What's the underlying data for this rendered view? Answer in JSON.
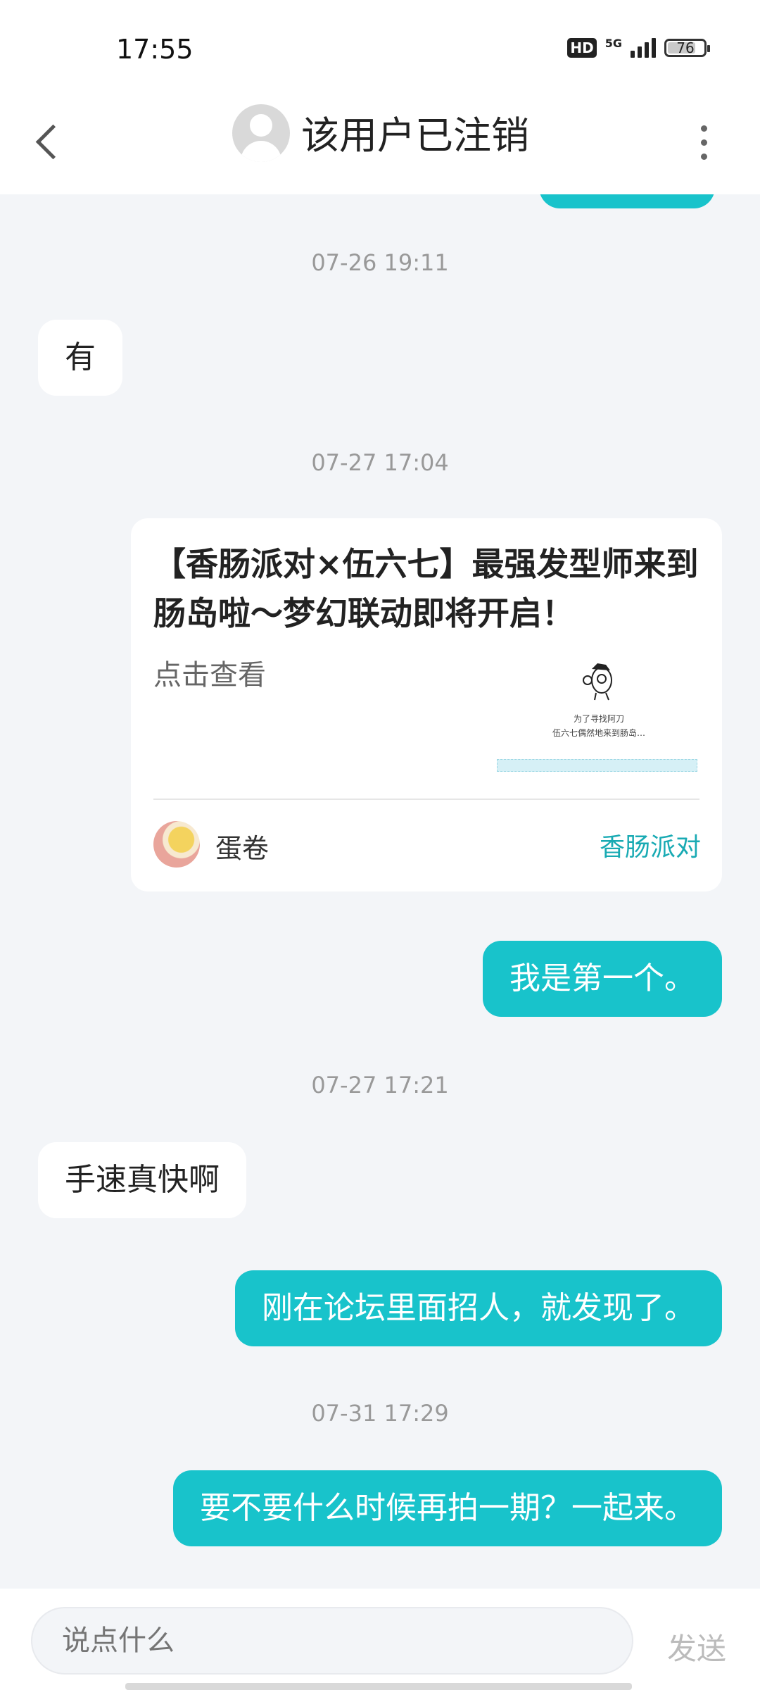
{
  "status_bar": {
    "time": "17:55",
    "network_hd": "HD",
    "network_5g": "5G",
    "battery": "76"
  },
  "header": {
    "title": "该用户已注销"
  },
  "messages": {
    "ts1": "07-26 19:11",
    "m1": "有",
    "ts2": "07-27 17:04",
    "card": {
      "title": "【香肠派对×伍六七】最强发型师来到肠岛啦～梦幻联动即将开启！",
      "subtitle": "点击查看",
      "thumb_caption_1": "为了寻找阿刀",
      "thumb_caption_2": "伍六七偶然地来到肠岛…",
      "author": "蛋卷",
      "tag": "香肠派对"
    },
    "m2": "我是第一个。",
    "ts3": "07-27 17:21",
    "m3": "手速真快啊",
    "m4": "刚在论坛里面招人，就发现了。",
    "ts4": "07-31 17:29",
    "m5": "要不要什么时候再拍一期？一起来。"
  },
  "input": {
    "placeholder": "说点什么",
    "send_label": "发送"
  },
  "colors": {
    "accent": "#18c3cb",
    "background": "#f3f5f8"
  }
}
